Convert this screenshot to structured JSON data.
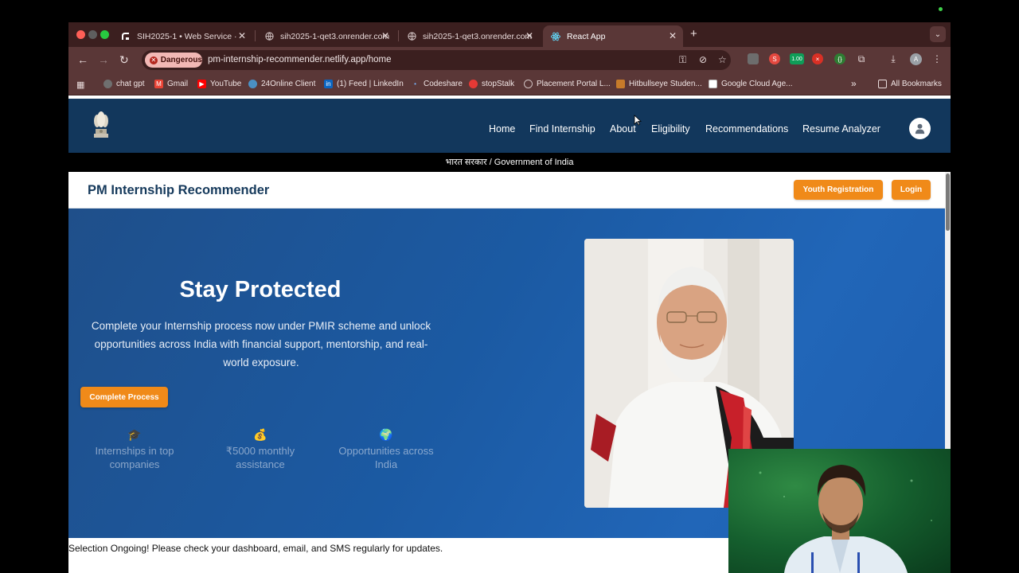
{
  "browser": {
    "tabs": [
      {
        "label": "SIH2025-1 • Web Service ·",
        "icon": "render-icon"
      },
      {
        "label": "sih2025-1-qet3.onrender.com",
        "icon": "globe-icon"
      },
      {
        "label": "sih2025-1-qet3.onrender.com",
        "icon": "globe-icon"
      },
      {
        "label": "React App",
        "icon": "react-icon",
        "active": true
      }
    ],
    "new_tab": "+",
    "security_chip": "Dangerous",
    "url": "pm-internship-recommender.netlify.app/home",
    "extension_badge": "1.00",
    "profile_initial": "A",
    "bookmarks": [
      "chat gpt",
      "Gmail",
      "YouTube",
      "24Online Client",
      "(1) Feed | LinkedIn",
      "Codeshare",
      "stopStalk",
      "Placement Portal L...",
      "Hitbullseye Studen...",
      "Google Cloud Age..."
    ],
    "all_bookmarks": "All Bookmarks",
    "overflow": "»"
  },
  "site": {
    "nav": [
      "Home",
      "Find Internship",
      "About",
      "Eligibility",
      "Recommendations",
      "Resume Analyzer"
    ],
    "gov_strip": "भारत सरकार / Government of India",
    "brand": "PM Internship Recommender",
    "youth_registration": "Youth Registration",
    "login": "Login",
    "hero": {
      "title": "Stay Protected",
      "description": "Complete your Internship process now under PMIR scheme and unlock opportunities across India with financial support, mentorship, and real-world exposure.",
      "cta": "Complete Process",
      "features": [
        {
          "icon": "graduation-cap-icon",
          "glyph": "🎓",
          "text": "Internships in top companies"
        },
        {
          "icon": "money-bag-icon",
          "glyph": "💰",
          "text": "₹5000 monthly assistance"
        },
        {
          "icon": "globe-icon",
          "glyph": "🌍",
          "text": "Opportunities across India"
        }
      ]
    },
    "marquee": "Selection Ongoing! Please check your dashboard, email, and SMS regularly for updates."
  },
  "colors": {
    "nav_bg": "#12375c",
    "accent": "#f08a19",
    "hero_bg": "#1b5aa3",
    "browser_dark": "#3b1f1f",
    "browser_toolbar": "#5a3737"
  }
}
